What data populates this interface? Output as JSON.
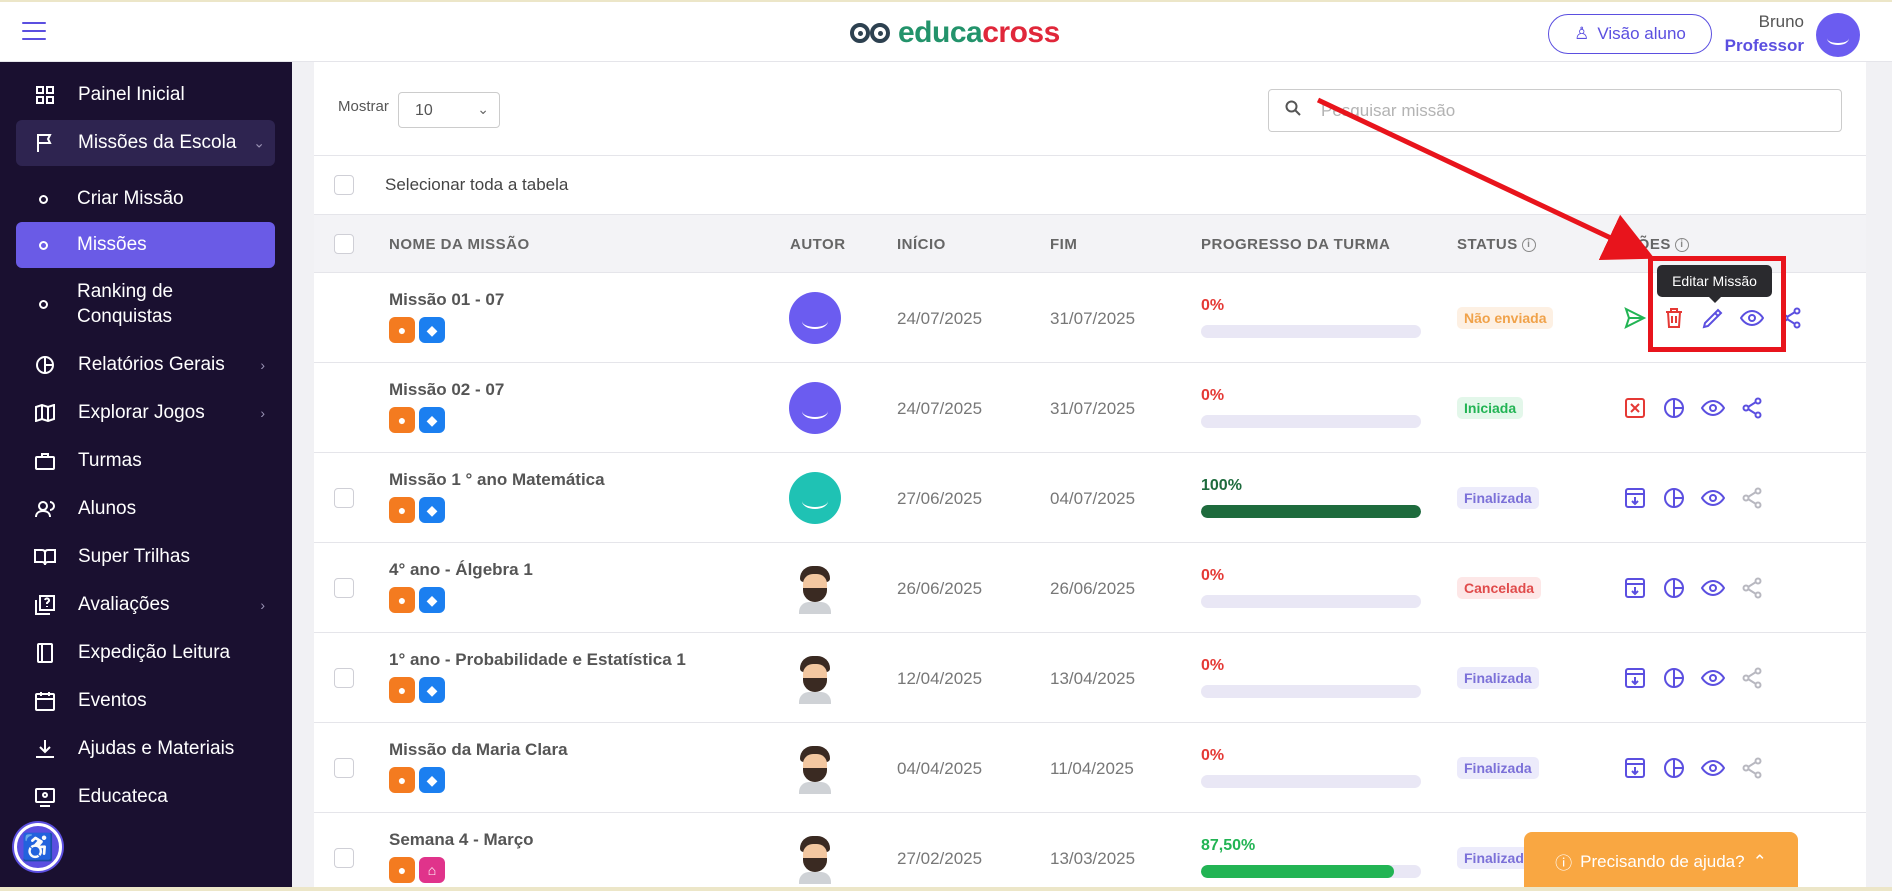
{
  "header": {
    "brand_left": "educa",
    "brand_right": "cross",
    "visao_aluno": "Visão aluno",
    "user_name": "Bruno",
    "user_role": "Professor"
  },
  "sidebar": {
    "items": [
      {
        "label": "Painel Inicial",
        "icon": "grid-icon"
      },
      {
        "label": "Missões da Escola",
        "icon": "flag-icon"
      },
      {
        "label": "Criar Missão",
        "icon": "circle-icon"
      },
      {
        "label": "Missões",
        "icon": "circle-icon"
      },
      {
        "label": "Ranking de Conquistas",
        "icon": "circle-icon"
      },
      {
        "label": "Relatórios Gerais",
        "icon": "pie-chart-icon"
      },
      {
        "label": "Explorar Jogos",
        "icon": "map-icon"
      },
      {
        "label": "Turmas",
        "icon": "briefcase-icon"
      },
      {
        "label": "Alunos",
        "icon": "users-icon"
      },
      {
        "label": "Super Trilhas",
        "icon": "book-open-icon"
      },
      {
        "label": "Avaliações",
        "icon": "quiz-icon"
      },
      {
        "label": "Expedição Leitura",
        "icon": "book-icon"
      },
      {
        "label": "Eventos",
        "icon": "calendar-icon"
      },
      {
        "label": "Ajudas e Materiais",
        "icon": "download-icon"
      },
      {
        "label": "Educateca",
        "icon": "screen-icon"
      }
    ],
    "ranking_line1": "Ranking de",
    "ranking_line2": "Conquistas"
  },
  "toolbar": {
    "mostrar_label": "Mostrar",
    "mostrar_value": "10",
    "search_placeholder": "Pesquisar missão",
    "select_all_label": "Selecionar toda a tabela"
  },
  "table": {
    "columns": {
      "name": "NOME DA MISSÃO",
      "author": "AUTOR",
      "start": "INÍCIO",
      "end": "FIM",
      "progress": "PROGRESSO DA TURMA",
      "status": "STATUS",
      "actions": "AÇÕES"
    },
    "rows": [
      {
        "name": "Missão 01 - 07",
        "start": "24/07/2025",
        "end": "31/07/2025",
        "progress_text": "0%",
        "progress": 0,
        "status": "Não enviada"
      },
      {
        "name": "Missão 02 - 07",
        "start": "24/07/2025",
        "end": "31/07/2025",
        "progress_text": "0%",
        "progress": 0,
        "status": "Iniciada"
      },
      {
        "name": "Missão 1 ° ano Matemática",
        "start": "27/06/2025",
        "end": "04/07/2025",
        "progress_text": "100%",
        "progress": 100,
        "status": "Finalizada"
      },
      {
        "name": "4° ano - Álgebra 1",
        "start": "26/06/2025",
        "end": "26/06/2025",
        "progress_text": "0%",
        "progress": 0,
        "status": "Cancelada"
      },
      {
        "name": "1° ano - Probabilidade e Estatística 1",
        "start": "12/04/2025",
        "end": "13/04/2025",
        "progress_text": "0%",
        "progress": 0,
        "status": "Finalizada"
      },
      {
        "name": "Missão da Maria Clara",
        "start": "04/04/2025",
        "end": "11/04/2025",
        "progress_text": "0%",
        "progress": 0,
        "status": "Finalizada"
      },
      {
        "name": "Semana 4 - Março",
        "start": "27/02/2025",
        "end": "13/03/2025",
        "progress_text": "87,50%",
        "progress": 87.5,
        "status": "Finalizada"
      }
    ]
  },
  "tooltip": "Editar Missão",
  "help_button": "Precisando de ajuda?",
  "colors": {
    "primary": "#5b4fe0",
    "sidebar_bg": "#1a1030",
    "annotation_red": "#e8141c",
    "help_orange": "#f9a742"
  }
}
